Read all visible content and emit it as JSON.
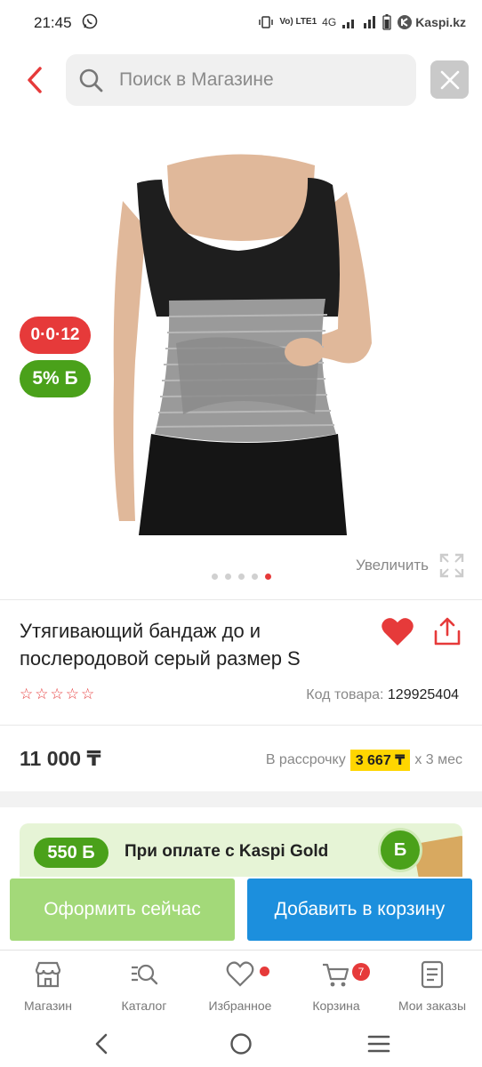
{
  "status_bar": {
    "time": "21:45",
    "network": "4G",
    "volte": "Vo) LTE1",
    "brand": "Kaspi.kz"
  },
  "search": {
    "placeholder": "Поиск в Магазине"
  },
  "badges": {
    "installment": "0·0·12",
    "bonus": "5% Б"
  },
  "gallery": {
    "zoom_label": "Увеличить",
    "dot_count": 5,
    "active_dot": 4
  },
  "product": {
    "title": "Утягивающий бандаж до и послеродовой серый размер S",
    "rating_stars": 5,
    "sku_label": "Код товара:",
    "sku_value": "129925404",
    "price": "11 000 ₸",
    "installment_prefix": "В рассрочку",
    "installment_monthly": "3 667 ₸",
    "installment_suffix": "х 3 мес"
  },
  "promo": {
    "bonus": "550 Б",
    "text": "При оплате с Kaspi Gold",
    "coin": "Б"
  },
  "actions": {
    "checkout": "Оформить сейчас",
    "add_to_cart": "Добавить в корзину"
  },
  "tabs": [
    {
      "label": "Магазин",
      "icon": "shop-icon"
    },
    {
      "label": "Каталог",
      "icon": "catalog-icon"
    },
    {
      "label": "Избранное",
      "icon": "heart-outline-icon"
    },
    {
      "label": "Корзина",
      "icon": "cart-icon",
      "badge": "7"
    },
    {
      "label": "Мои заказы",
      "icon": "orders-icon"
    }
  ],
  "colors": {
    "accent_red": "#e63a3a",
    "green": "#4aa11a",
    "blue": "#1c8fdd",
    "yellow": "#ffd600"
  }
}
